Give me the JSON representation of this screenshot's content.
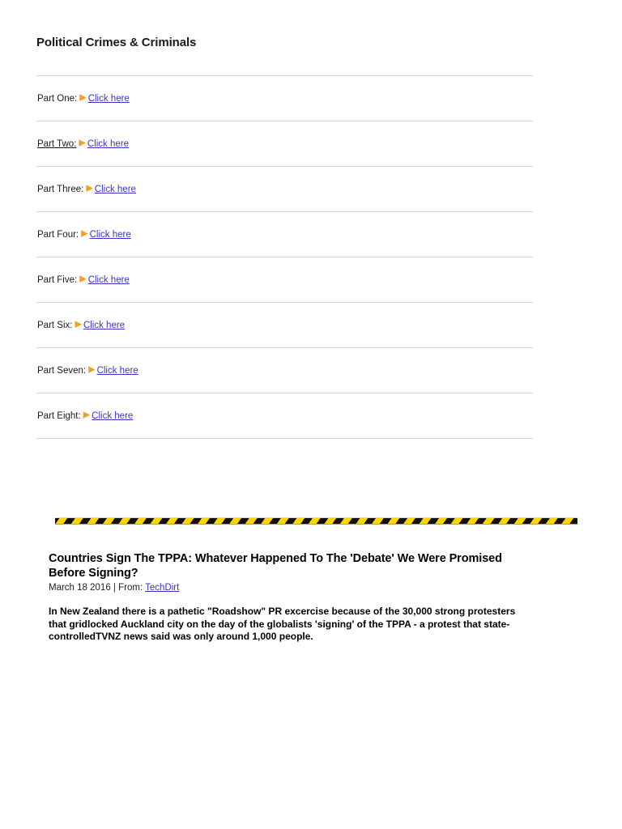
{
  "page": {
    "title": "Political Crimes & Criminals"
  },
  "colors": {
    "link": "#3a34c8",
    "bullet": "#f0a020",
    "rule": "#d9d9d9",
    "hazard_yellow": "#ffd500",
    "hazard_black": "#111111",
    "text": "#1a1a1a"
  },
  "parts": [
    {
      "label": "Part One:",
      "bullet": "play-triangle-icon",
      "link_label": "Click here",
      "label_underlined": false
    },
    {
      "label": "Part Two:",
      "bullet": "play-triangle-icon",
      "link_label": "Click here",
      "label_underlined": true
    },
    {
      "label": "Part Three:",
      "bullet": "play-triangle-icon",
      "link_label": "Click here",
      "label_underlined": false
    },
    {
      "label": "Part Four:",
      "bullet": "play-triangle-icon",
      "link_label": "Click here",
      "label_underlined": false
    },
    {
      "label": "Part Five:",
      "bullet": "play-triangle-icon",
      "link_label": "Click here",
      "label_underlined": false
    },
    {
      "label": "Part Six:",
      "bullet": "play-triangle-icon",
      "link_label": "Click here",
      "label_underlined": false
    },
    {
      "label": "Part Seven:",
      "bullet": "play-triangle-icon",
      "link_label": "Click here",
      "label_underlined": false
    },
    {
      "label": "Part Eight:",
      "bullet": "play-triangle-icon",
      "link_label": "Click here",
      "label_underlined": false
    }
  ],
  "divider": {
    "name": "hazard-stripe-divider"
  },
  "article": {
    "headline": "Countries Sign The TPPA: Whatever Happened To The 'Debate' We Were Promised Before Signing?",
    "date": "March 18 2016",
    "separator": "|",
    "from_label": "From:",
    "source": "TechDirt",
    "body": "In New Zealand there is a pathetic \"Roadshow\" PR excercise because of the 30,000 strong protesters that gridlocked Auckland city on the day of the globalists 'signing' of the TPPA - a protest that state-controlledTVNZ news said was only around 1,000 people."
  },
  "icons": {
    "play_triangle": "▶"
  }
}
